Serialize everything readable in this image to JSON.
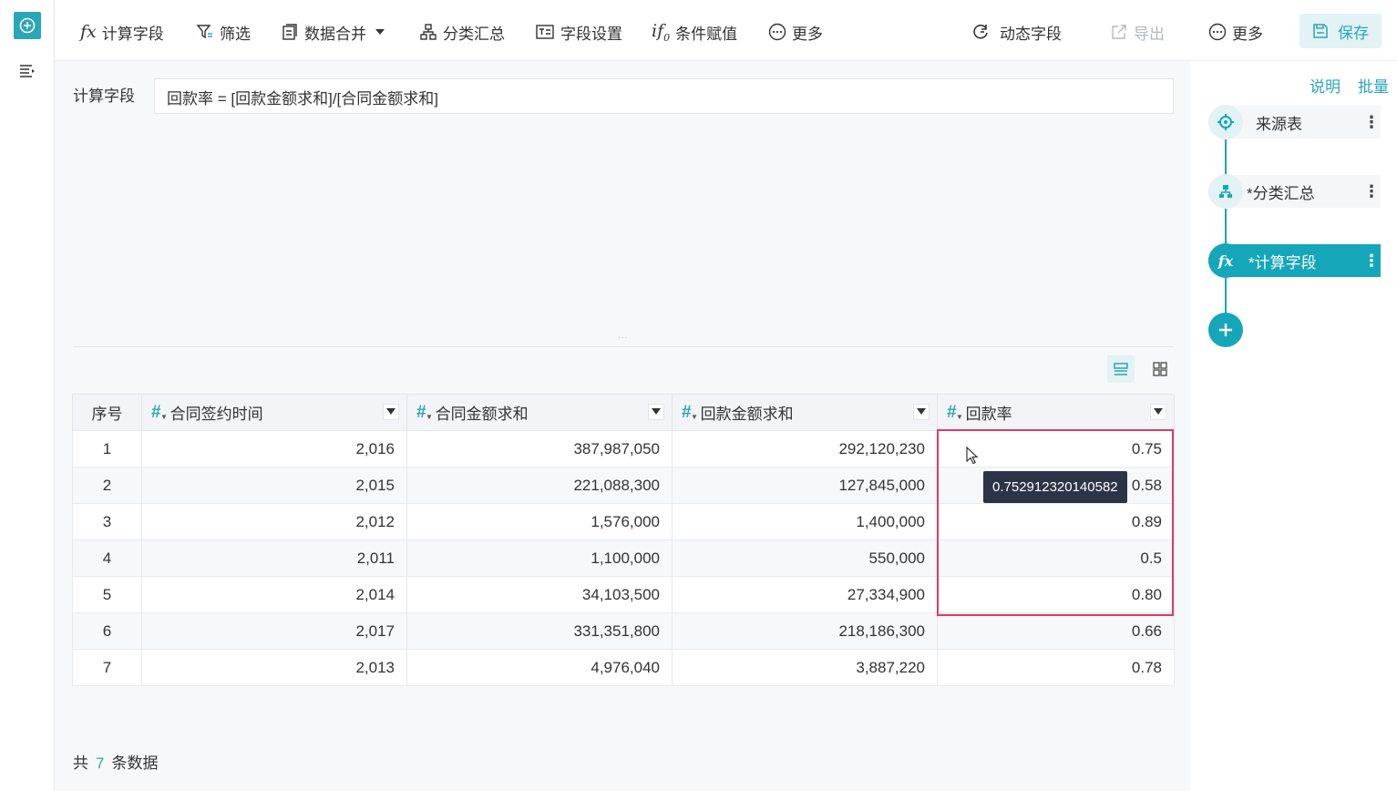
{
  "toolbar": {
    "calc_field": "计算字段",
    "filter": "筛选",
    "merge": "数据合并",
    "group_summary": "分类汇总",
    "field_settings": "字段设置",
    "conditional": "条件赋值",
    "more_left": "更多",
    "dynamic_field": "动态字段",
    "export": "导出",
    "more_right": "更多",
    "save": "保存"
  },
  "formula": {
    "label": "计算字段",
    "value": "回款率 = [回款金额求和]/[合同金额求和]"
  },
  "drag_handle": "...",
  "table": {
    "headers": [
      "序号",
      "合同签约时间",
      "合同金额求和",
      "回款金额求和",
      "回款率"
    ],
    "rows": [
      [
        "1",
        "2,016",
        "387,987,050",
        "292,120,230",
        "0.75"
      ],
      [
        "2",
        "2,015",
        "221,088,300",
        "127,845,000",
        "0.58"
      ],
      [
        "3",
        "2,012",
        "1,576,000",
        "1,400,000",
        "0.89"
      ],
      [
        "4",
        "2,011",
        "1,100,000",
        "550,000",
        "0.5"
      ],
      [
        "5",
        "2,014",
        "34,103,500",
        "27,334,900",
        "0.80"
      ],
      [
        "6",
        "2,017",
        "331,351,800",
        "218,186,300",
        "0.66"
      ],
      [
        "7",
        "2,013",
        "4,976,040",
        "3,887,220",
        "0.78"
      ]
    ]
  },
  "tooltip": "0.752912320140582",
  "footer": {
    "prefix": "共",
    "count": "7",
    "suffix": "条数据"
  },
  "right_panel": {
    "explain": "说明",
    "batch": "批量",
    "nodes": [
      "来源表",
      "*分类汇总",
      "*计算字段"
    ]
  },
  "colors": {
    "accent": "#15a6ba",
    "highlight_border": "#e0386a",
    "tooltip_bg": "#2c3448"
  }
}
